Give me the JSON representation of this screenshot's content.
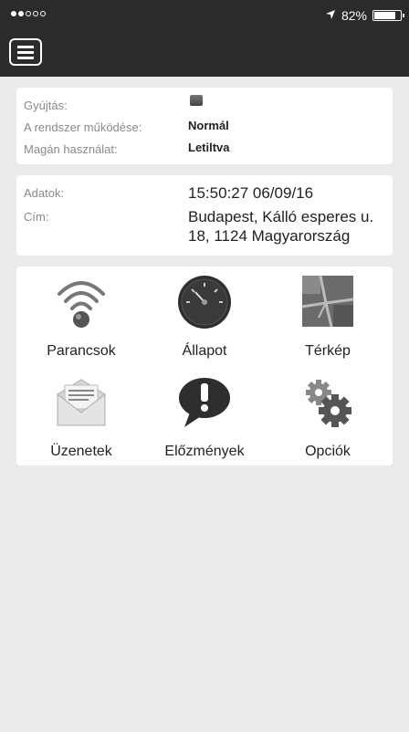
{
  "status_bar": {
    "signal_dots_on": 2,
    "signal_dots_total": 5,
    "location_icon": "location-arrow-icon",
    "battery_percent": "82%",
    "battery_level": 0.82
  },
  "nav": {
    "menu_icon": "menu-icon"
  },
  "vehicle": {
    "ignition_label": "Gyújtás:",
    "system_label": "A rendszer működése:",
    "system_value": "Normál",
    "private_label": "Magán használat:",
    "private_value": "Letiltva"
  },
  "info": {
    "data_label": "Adatok:",
    "data_value": "15:50:27 06/09/16",
    "address_label": "Cím:",
    "address_value_line1": "Budapest, Kálló esperes u.",
    "address_value_line2": "18, 1124 Magyarország"
  },
  "tiles": [
    {
      "label": "Parancsok",
      "icon": "wifi-signal-icon"
    },
    {
      "label": "Állapot",
      "icon": "speedometer-icon"
    },
    {
      "label": "Térkép",
      "icon": "map-icon"
    },
    {
      "label": "Üzenetek",
      "icon": "envelope-icon"
    },
    {
      "label": "Előzmények",
      "icon": "exclamation-bubble-icon"
    },
    {
      "label": "Opciók",
      "icon": "gears-icon"
    }
  ],
  "colors": {
    "bar": "#2b2b2b",
    "background": "#ebebeb",
    "card": "#ffffff"
  }
}
